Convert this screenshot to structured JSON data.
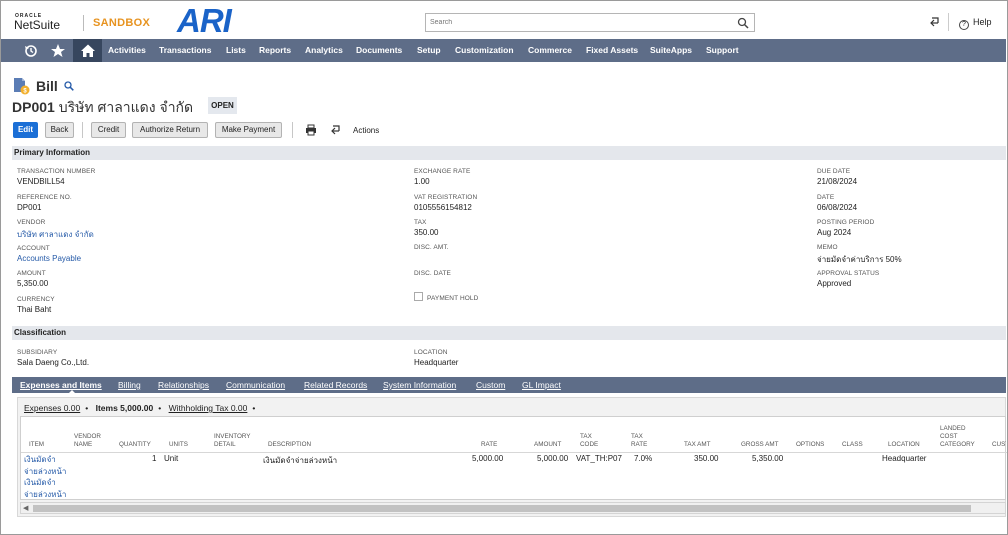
{
  "header": {
    "oracle": "ORACLE",
    "netsuite": "NetSuite",
    "sandbox": "SANDBOX",
    "brand": "ARI",
    "search_placeholder": "Search",
    "help": "Help"
  },
  "nav": {
    "items": [
      "Activities",
      "Transactions",
      "Lists",
      "Reports",
      "Analytics",
      "Documents",
      "Setup",
      "Customization",
      "Commerce",
      "Fixed Assets",
      "SuiteApps",
      "Support"
    ]
  },
  "record": {
    "type": "Bill",
    "number": "DP001",
    "entity": "บริษัท ศาลาแดง จำกัด",
    "status": "OPEN"
  },
  "buttons": {
    "edit": "Edit",
    "back": "Back",
    "credit": "Credit",
    "authorize_return": "Authorize Return",
    "make_payment": "Make Payment",
    "actions": "Actions"
  },
  "primary": {
    "title": "Primary Information",
    "transaction_number": {
      "label": "TRANSACTION NUMBER",
      "value": "VENDBILL54"
    },
    "reference_no": {
      "label": "REFERENCE NO.",
      "value": "DP001"
    },
    "vendor": {
      "label": "VENDOR",
      "value": "บริษัท ศาลาแดง จำกัด"
    },
    "account": {
      "label": "ACCOUNT",
      "value": "Accounts Payable"
    },
    "amount": {
      "label": "AMOUNT",
      "value": "5,350.00"
    },
    "currency": {
      "label": "CURRENCY",
      "value": "Thai Baht"
    },
    "exchange_rate": {
      "label": "EXCHANGE RATE",
      "value": "1.00"
    },
    "vat_registration": {
      "label": "VAT REGISTRATION",
      "value": "0105556154812"
    },
    "tax": {
      "label": "TAX",
      "value": "350.00"
    },
    "disc_amt": {
      "label": "DISC. AMT.",
      "value": ""
    },
    "disc_date": {
      "label": "DISC. DATE",
      "value": ""
    },
    "payment_hold": {
      "label": "PAYMENT HOLD"
    },
    "due_date": {
      "label": "DUE DATE",
      "value": "21/08/2024"
    },
    "date": {
      "label": "DATE",
      "value": "06/08/2024"
    },
    "posting_period": {
      "label": "POSTING PERIOD",
      "value": "Aug 2024"
    },
    "memo": {
      "label": "MEMO",
      "value": "จ่ายมัดจำค่าบริการ 50%"
    },
    "approval_status": {
      "label": "APPROVAL STATUS",
      "value": "Approved"
    }
  },
  "classification": {
    "title": "Classification",
    "subsidiary": {
      "label": "SUBSIDIARY",
      "value": "Sala Daeng Co.,Ltd."
    },
    "location": {
      "label": "LOCATION",
      "value": "Headquarter"
    }
  },
  "subtabs": [
    "Expenses and Items",
    "Billing",
    "Relationships",
    "Communication",
    "Related Records",
    "System Information",
    "Custom",
    "GL Impact"
  ],
  "chips": {
    "expenses": "Expenses 0.00",
    "items": "Items 5,000.00",
    "withholding": "Withholding Tax 0.00"
  },
  "grid": {
    "columns": [
      "ITEM",
      "VENDOR NAME",
      "QUANTITY",
      "UNITS",
      "INVENTORY DETAIL",
      "DESCRIPTION",
      "RATE",
      "AMOUNT",
      "TAX CODE",
      "TAX RATE",
      "TAX AMT",
      "GROSS AMT",
      "OPTIONS",
      "CLASS",
      "LOCATION",
      "LANDED COST CATEGORY",
      "CUST"
    ],
    "rows": [
      {
        "item_lines": [
          "เงินมัดจำ",
          "จ่ายล่วงหน้า",
          "เงินมัดจำ",
          "จ่ายล่วงหน้า"
        ],
        "vendor_name": "",
        "quantity": "1",
        "units": "Unit",
        "inventory_detail": "",
        "description": "เงินมัดจำจ่ายล่วงหน้า",
        "rate": "5,000.00",
        "amount": "5,000.00",
        "tax_code": "VAT_TH:P07",
        "tax_rate": "7.0%",
        "tax_amt": "350.00",
        "gross_amt": "5,350.00",
        "options": "",
        "class": "",
        "location": "Headquarter"
      }
    ]
  }
}
